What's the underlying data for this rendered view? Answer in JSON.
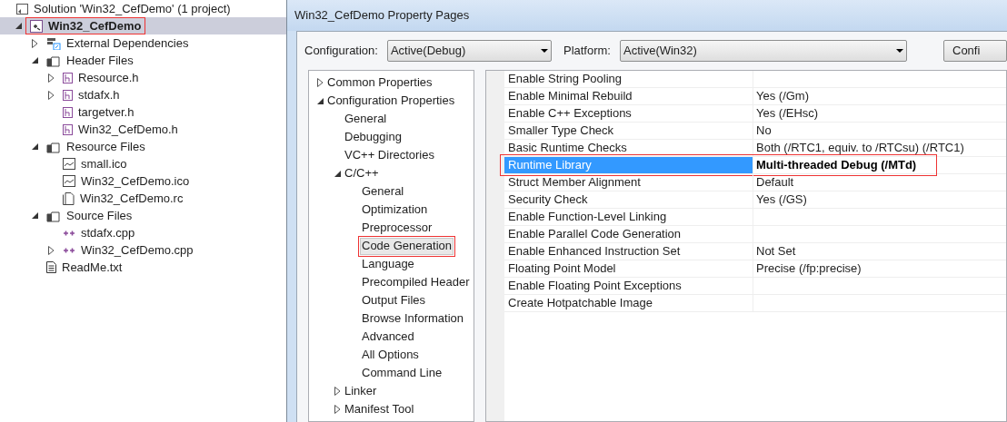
{
  "solution_explorer": {
    "solution": "Solution 'Win32_CefDemo' (1 project)",
    "items": [
      {
        "label": "Win32_CefDemo",
        "kind": "project",
        "expanded": true,
        "selected": true,
        "boxed": true,
        "children": [
          {
            "label": "External Dependencies",
            "kind": "references",
            "expanded": false,
            "selected": false,
            "boxed": false
          },
          {
            "label": "Header Files",
            "kind": "folder",
            "expanded": true,
            "selected": false,
            "boxed": false,
            "children": [
              {
                "label": "Resource.h",
                "kind": "header",
                "expanded": false,
                "selected": false,
                "boxed": false
              },
              {
                "label": "stdafx.h",
                "kind": "header",
                "expanded": false,
                "selected": false,
                "boxed": false
              },
              {
                "label": "targetver.h",
                "kind": "header",
                "selected": false,
                "boxed": false
              },
              {
                "label": "Win32_CefDemo.h",
                "kind": "header",
                "selected": false,
                "boxed": false
              }
            ]
          },
          {
            "label": "Resource Files",
            "kind": "folder",
            "expanded": true,
            "selected": false,
            "boxed": false,
            "children": [
              {
                "label": "small.ico",
                "kind": "image",
                "selected": false,
                "boxed": false
              },
              {
                "label": "Win32_CefDemo.ico",
                "kind": "image",
                "selected": false,
                "boxed": false
              },
              {
                "label": "Win32_CefDemo.rc",
                "kind": "resource",
                "selected": false,
                "boxed": false
              }
            ]
          },
          {
            "label": "Source Files",
            "kind": "folder",
            "expanded": true,
            "selected": false,
            "boxed": false,
            "children": [
              {
                "label": "stdafx.cpp",
                "kind": "source",
                "selected": false,
                "boxed": false
              },
              {
                "label": "Win32_CefDemo.cpp",
                "kind": "source",
                "expanded": false,
                "selected": false,
                "boxed": false
              }
            ]
          },
          {
            "label": "ReadMe.txt",
            "kind": "text",
            "selected": false,
            "boxed": false
          }
        ]
      }
    ]
  },
  "dialog": {
    "title": "Win32_CefDemo Property Pages",
    "configuration": {
      "label": "Configuration:",
      "value": "Active(Debug)"
    },
    "platform": {
      "label": "Platform:",
      "value": "Active(Win32)"
    },
    "manager_button": "Confi",
    "nav": [
      {
        "label": "Common Properties",
        "expanded": false,
        "selected": false,
        "boxed": false
      },
      {
        "label": "Configuration Properties",
        "expanded": true,
        "selected": false,
        "boxed": false,
        "children": [
          {
            "label": "General",
            "selected": false,
            "boxed": false
          },
          {
            "label": "Debugging",
            "selected": false,
            "boxed": false
          },
          {
            "label": "VC++ Directories",
            "selected": false,
            "boxed": false
          },
          {
            "label": "C/C++",
            "expanded": true,
            "selected": false,
            "boxed": false,
            "children": [
              {
                "label": "General",
                "selected": false,
                "boxed": false
              },
              {
                "label": "Optimization",
                "selected": false,
                "boxed": false
              },
              {
                "label": "Preprocessor",
                "selected": false,
                "boxed": false
              },
              {
                "label": "Code Generation",
                "selected": true,
                "boxed": true
              },
              {
                "label": "Language",
                "selected": false,
                "boxed": false
              },
              {
                "label": "Precompiled Header",
                "selected": false,
                "boxed": false
              },
              {
                "label": "Output Files",
                "selected": false,
                "boxed": false
              },
              {
                "label": "Browse Information",
                "selected": false,
                "boxed": false
              },
              {
                "label": "Advanced",
                "selected": false,
                "boxed": false
              },
              {
                "label": "All Options",
                "selected": false,
                "boxed": false
              },
              {
                "label": "Command Line",
                "selected": false,
                "boxed": false
              }
            ]
          },
          {
            "label": "Linker",
            "expanded": false,
            "selected": false,
            "boxed": false
          },
          {
            "label": "Manifest Tool",
            "expanded": false,
            "selected": false,
            "boxed": false
          }
        ]
      }
    ],
    "properties": [
      {
        "name": "Enable String Pooling",
        "selected": false,
        "boxed": false
      },
      {
        "name": "Enable Minimal Rebuild",
        "value": "Yes (/Gm)",
        "selected": false,
        "modified": false,
        "boxed": false
      },
      {
        "name": "Enable C++ Exceptions",
        "value": "Yes (/EHsc)",
        "selected": false,
        "modified": false,
        "boxed": false
      },
      {
        "name": "Smaller Type Check",
        "value": "No",
        "selected": false,
        "modified": false,
        "boxed": false
      },
      {
        "name": "Basic Runtime Checks",
        "value": "Both (/RTC1, equiv. to /RTCsu) (/RTC1)",
        "selected": false,
        "modified": false,
        "boxed": false
      },
      {
        "name": "Runtime Library",
        "value": "Multi-threaded Debug (/MTd)",
        "selected": true,
        "modified": true,
        "boxed": true
      },
      {
        "name": "Struct Member Alignment",
        "value": "Default",
        "selected": false,
        "modified": false,
        "boxed": false
      },
      {
        "name": "Security Check",
        "value": "Yes (/GS)",
        "selected": false,
        "modified": false,
        "boxed": false
      },
      {
        "name": "Enable Function-Level Linking",
        "selected": false,
        "boxed": false
      },
      {
        "name": "Enable Parallel Code Generation",
        "selected": false,
        "boxed": false
      },
      {
        "name": "Enable Enhanced Instruction Set",
        "value": "Not Set",
        "selected": false,
        "modified": false,
        "boxed": false
      },
      {
        "name": "Floating Point Model",
        "value": "Precise (/fp:precise)",
        "selected": false,
        "modified": false,
        "boxed": false
      },
      {
        "name": "Enable Floating Point Exceptions",
        "selected": false,
        "boxed": false
      },
      {
        "name": "Create Hotpatchable Image",
        "selected": false,
        "boxed": false
      }
    ]
  }
}
